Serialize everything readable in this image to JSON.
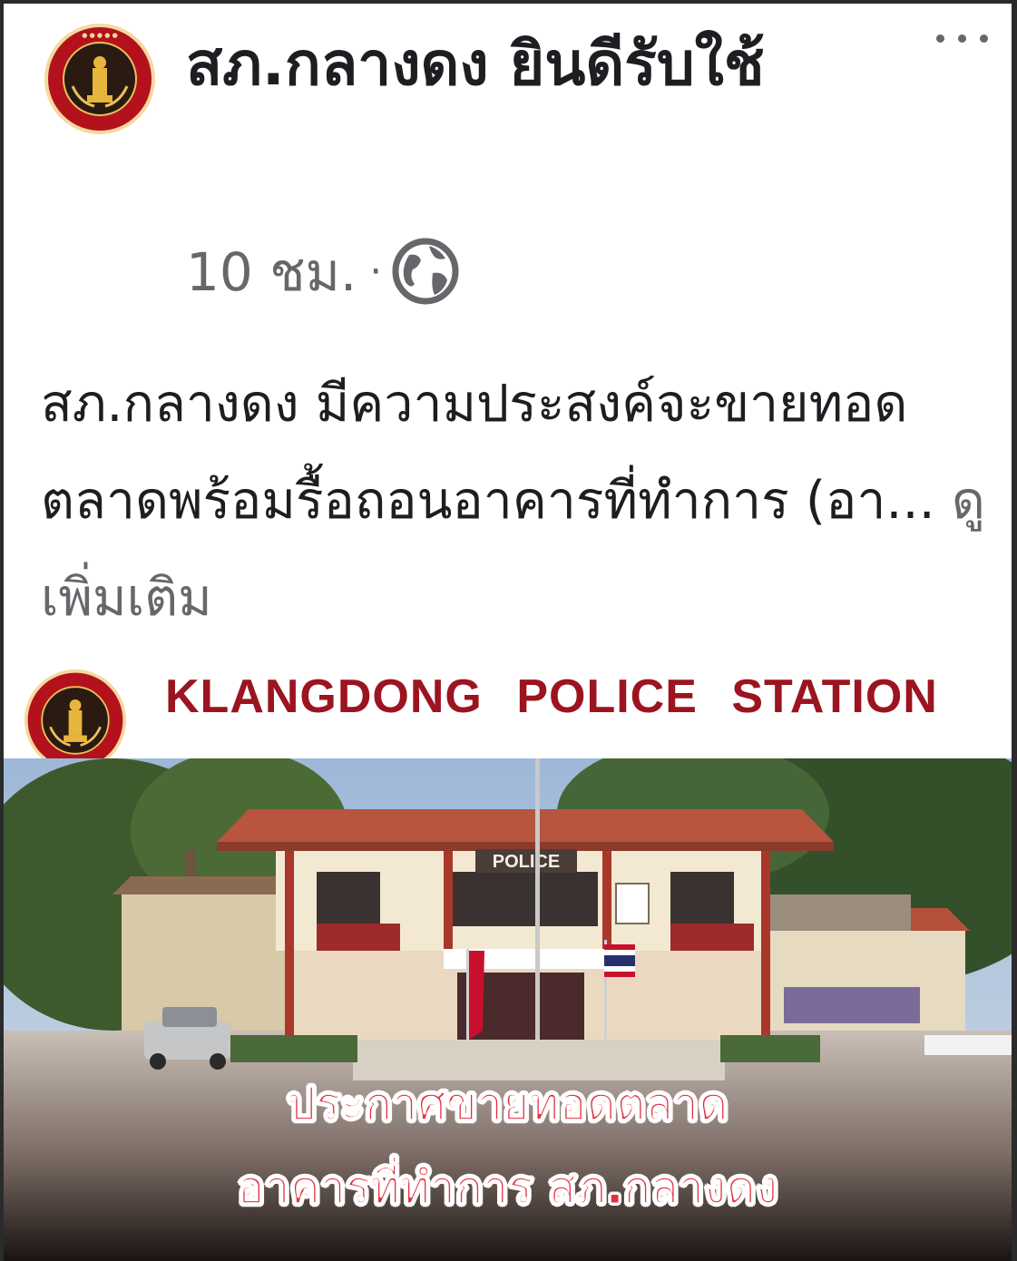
{
  "post": {
    "page_name": "สภ.กลางดง ยินดีรับใช้",
    "time": "10 ชม.",
    "separator": "·",
    "audience_icon": "globe-icon",
    "more_icon": "more-options-icon",
    "text": "สภ.กลางดง มีความประสงค์จะขายทอดตลาดพร้อมรื้อถอนอาคารที่ทำการ (อา...",
    "see_more": "ดูเพิ่มเติม"
  },
  "media": {
    "banner_title": "KLANGDONG POLICE STATION",
    "building_sign": "POLICE",
    "caption_line1": "ประกาศขายทอดตลาด",
    "caption_line2": "อาคารที่ทำการ สภ.กลางดง",
    "logo_ring_text": "KLANGDONG POLICE STATION"
  },
  "colors": {
    "brand_red": "#9b1420",
    "caption_red": "#e0303f",
    "secondary_text": "#65676b"
  }
}
